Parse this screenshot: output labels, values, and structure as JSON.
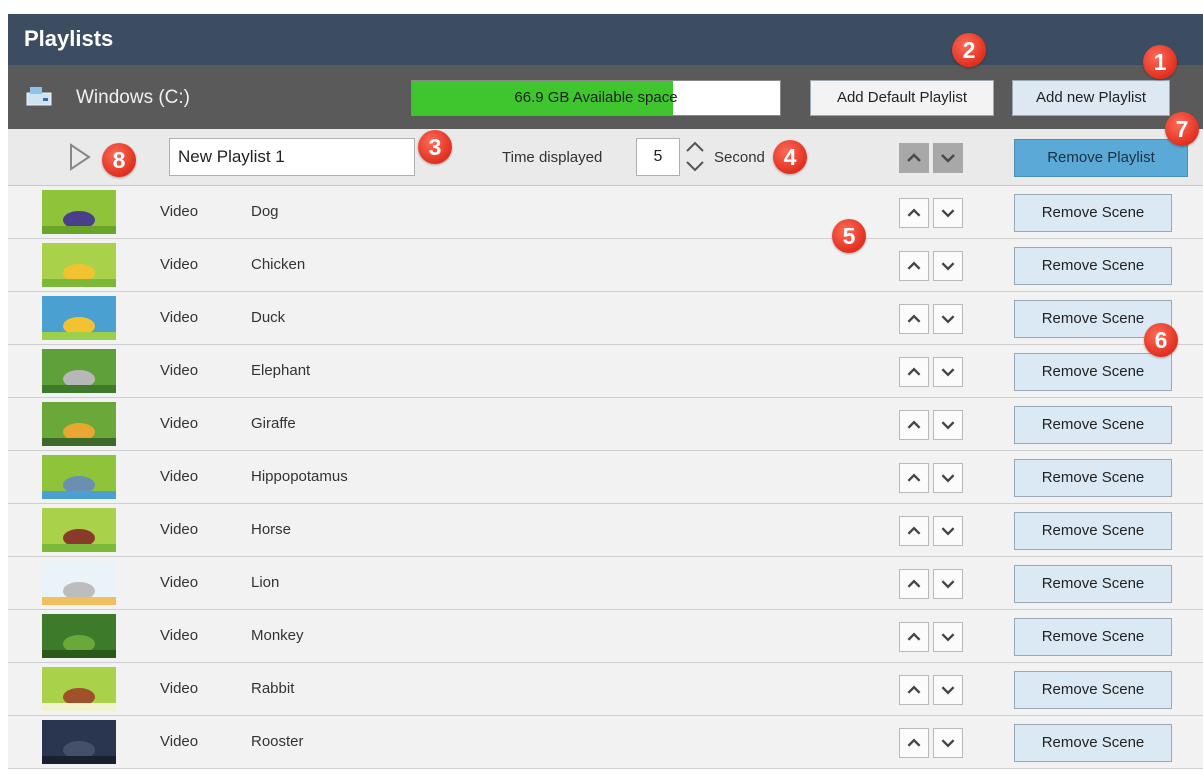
{
  "window": {
    "title": "Playlists"
  },
  "drive": {
    "label": "Windows (C:)",
    "space_text": "66.9 GB Available space",
    "used_fraction": 0.71
  },
  "toolbar": {
    "add_default_label": "Add Default Playlist",
    "add_new_label": "Add new Playlist"
  },
  "playlist": {
    "name": "New Playlist 1",
    "time_label": "Time displayed",
    "time_value": "5",
    "seconds_label": "Second",
    "remove_label": "Remove Playlist"
  },
  "scenes": [
    {
      "type": "Video",
      "name": "Dog",
      "remove_label": "Remove Scene"
    },
    {
      "type": "Video",
      "name": "Chicken",
      "remove_label": "Remove Scene"
    },
    {
      "type": "Video",
      "name": "Duck",
      "remove_label": "Remove Scene"
    },
    {
      "type": "Video",
      "name": "Elephant",
      "remove_label": "Remove Scene"
    },
    {
      "type": "Video",
      "name": "Giraffe",
      "remove_label": "Remove Scene"
    },
    {
      "type": "Video",
      "name": "Hippopotamus",
      "remove_label": "Remove Scene"
    },
    {
      "type": "Video",
      "name": "Horse",
      "remove_label": "Remove Scene"
    },
    {
      "type": "Video",
      "name": "Lion",
      "remove_label": "Remove Scene"
    },
    {
      "type": "Video",
      "name": "Monkey",
      "remove_label": "Remove Scene"
    },
    {
      "type": "Video",
      "name": "Rabbit",
      "remove_label": "Remove Scene"
    },
    {
      "type": "Video",
      "name": "Rooster",
      "remove_label": "Remove Scene"
    }
  ],
  "markers": [
    "1",
    "2",
    "3",
    "4",
    "5",
    "6",
    "7",
    "8"
  ],
  "colors": {
    "title_bar": "#3c4d62",
    "drive_bar": "#5a5a5a",
    "space_fill": "#3fc52e",
    "remove_playlist": "#5aa9d6",
    "marker": "#e0301f"
  }
}
